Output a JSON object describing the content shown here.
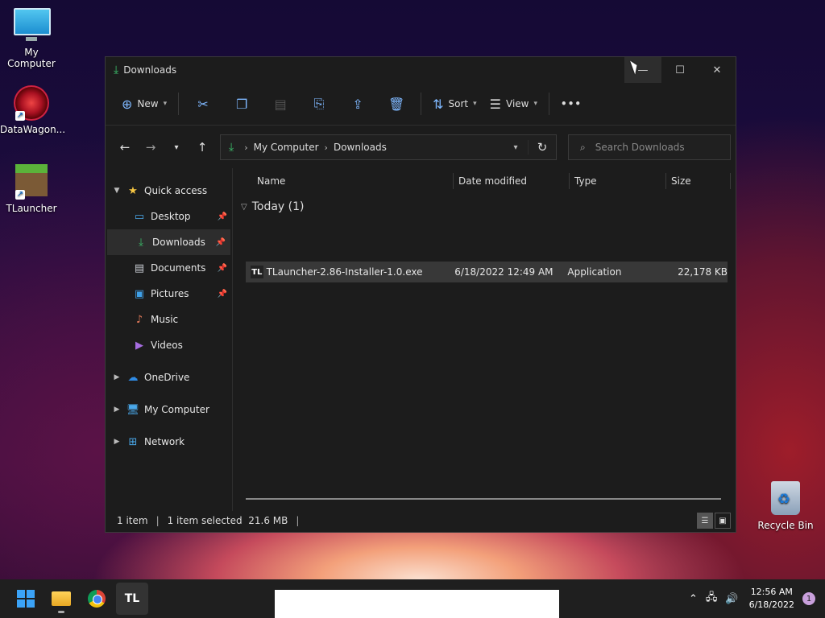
{
  "desktop": {
    "icons": [
      {
        "label": "My Computer"
      },
      {
        "label": "DataWagon..."
      },
      {
        "label": "TLauncher"
      }
    ],
    "recycle_bin": "Recycle Bin"
  },
  "window": {
    "title": "Downloads",
    "toolbar": {
      "new_label": "New",
      "sort_label": "Sort",
      "view_label": "View",
      "more_label": "•••"
    },
    "address": {
      "segments": [
        "My Computer",
        "Downloads"
      ]
    },
    "search": {
      "placeholder": "Search Downloads"
    },
    "sidebar": {
      "quick_access": "Quick access",
      "items": [
        {
          "label": "Desktop"
        },
        {
          "label": "Downloads"
        },
        {
          "label": "Documents"
        },
        {
          "label": "Pictures"
        },
        {
          "label": "Music"
        },
        {
          "label": "Videos"
        }
      ],
      "onedrive": "OneDrive",
      "my_computer": "My Computer",
      "network": "Network"
    },
    "columns": [
      "Name",
      "Date modified",
      "Type",
      "Size"
    ],
    "group": "Today (1)",
    "files": [
      {
        "name": "TLauncher-2.86-Installer-1.0.exe",
        "date": "6/18/2022 12:49 AM",
        "type": "Application",
        "size": "22,178 KB",
        "icon": "TL"
      }
    ],
    "status": {
      "count": "1 item",
      "selected": "1 item selected  21.6 MB"
    }
  },
  "taskbar": {
    "tl_label": "TL",
    "time": "12:56 AM",
    "date": "6/18/2022",
    "notifications": "1"
  }
}
